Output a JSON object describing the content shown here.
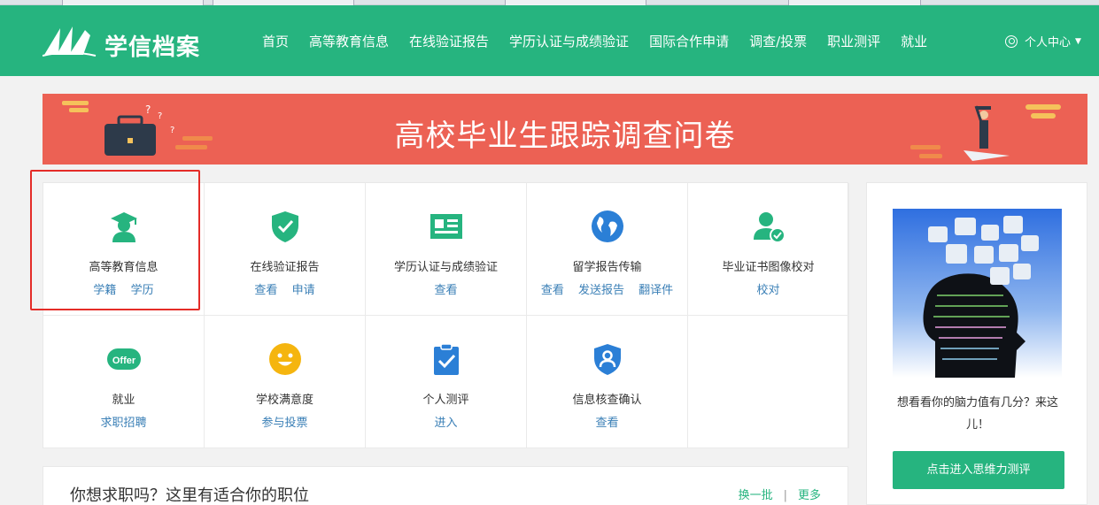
{
  "header": {
    "logo_text": "学信档案",
    "nav": [
      "首页",
      "高等教育信息",
      "在线验证报告",
      "学历认证与成绩验证",
      "国际合作申请",
      "调查/投票",
      "职业测评",
      "就业"
    ],
    "user_menu": "个人中心"
  },
  "banner": {
    "title": "高校毕业生跟踪调查问卷"
  },
  "services": [
    {
      "title": "高等教育信息",
      "icon": "graduate-icon",
      "links": [
        "学籍",
        "学历"
      ]
    },
    {
      "title": "在线验证报告",
      "icon": "shield-check-icon",
      "links": [
        "查看",
        "申请"
      ]
    },
    {
      "title": "学历认证与成绩验证",
      "icon": "id-card-icon",
      "links": [
        "查看"
      ]
    },
    {
      "title": "留学报告传输",
      "icon": "globe-icon",
      "links": [
        "查看",
        "发送报告",
        "翻译件"
      ]
    },
    {
      "title": "毕业证书图像校对",
      "icon": "user-check-icon",
      "links": [
        "校对"
      ]
    },
    {
      "title": "就业",
      "icon": "offer-icon",
      "links": [
        "求职招聘"
      ]
    },
    {
      "title": "学校满意度",
      "icon": "smiley-icon",
      "links": [
        "参与投票"
      ]
    },
    {
      "title": "个人测评",
      "icon": "clipboard-check-icon",
      "links": [
        "进入"
      ]
    },
    {
      "title": "信息核查确认",
      "icon": "shield-user-icon",
      "links": [
        "查看"
      ]
    }
  ],
  "offer_badge": "Offer",
  "side": {
    "text": "想看看你的脑力值有几分？来这儿！",
    "button": "点击进入思维力测评"
  },
  "jobs": {
    "title": "你想求职吗？这里有适合你的职位",
    "refresh": "换一批",
    "more": "更多"
  },
  "colors": {
    "brand": "#26b47f",
    "banner": "#ec6154",
    "link": "#3a7fb6",
    "highlight": "#e42c28"
  }
}
